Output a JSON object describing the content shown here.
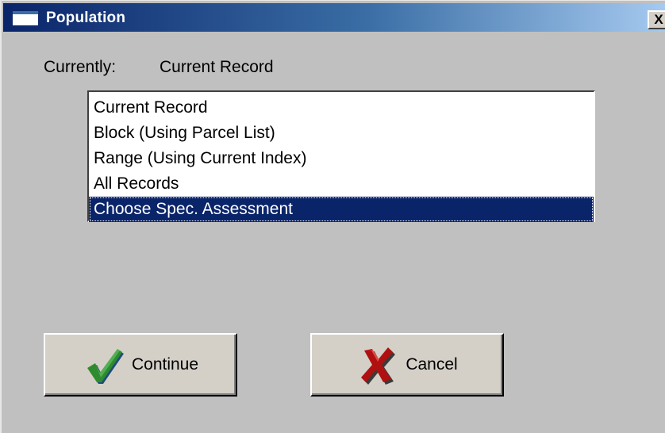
{
  "window": {
    "title": "Population",
    "close_glyph": "X"
  },
  "currently": {
    "label": "Currently:",
    "value": "Current Record"
  },
  "list": {
    "items": [
      {
        "label": "Current Record",
        "selected": false
      },
      {
        "label": "Block (Using Parcel List)",
        "selected": false
      },
      {
        "label": "Range (Using Current Index)",
        "selected": false
      },
      {
        "label": "All Records",
        "selected": false
      },
      {
        "label": "Choose Spec. Assessment",
        "selected": true
      }
    ]
  },
  "buttons": {
    "continue_label": "Continue",
    "cancel_label": "Cancel",
    "continue_icon": "checkmark-icon",
    "cancel_icon": "x-mark-icon"
  },
  "colors": {
    "titlebar_start": "#0a246a",
    "titlebar_end": "#a6caf0",
    "selection": "#0a246a",
    "window_bg": "#c0c0c0",
    "check_green": "#2e8b2e",
    "cancel_red": "#b01010"
  }
}
